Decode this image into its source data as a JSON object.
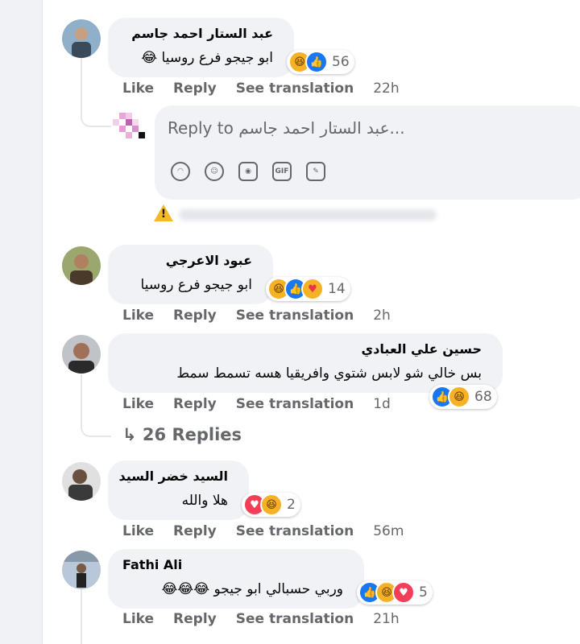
{
  "placeholder_avatar_note": "",
  "comments": [
    {
      "author": "عبد الستار احمد جاسم",
      "text": "ابو جيجو فرع روسيا",
      "text_emoji": "😂",
      "reactions": [
        "haha",
        "like"
      ],
      "reaction_count": "56",
      "actions": {
        "like": "Like",
        "reply": "Reply",
        "translate": "See translation",
        "time": "22h"
      },
      "avatar_color": "#6f8fa8"
    },
    {
      "author": "عبود الاعرجي",
      "text": "ابو جيجو فرع روسيا",
      "text_emoji": "",
      "reactions": [
        "haha",
        "like",
        "care"
      ],
      "reaction_count": "14",
      "actions": {
        "like": "Like",
        "reply": "Reply",
        "translate": "See translation",
        "time": "2h"
      },
      "avatar_color": "#6b7a4a"
    },
    {
      "author": "حسين علي العبادي",
      "text": "بس خالي شو لابس شتوي وافريقيا هسه تسمط سمط",
      "text_emoji": "",
      "reactions": [
        "like",
        "haha"
      ],
      "reaction_count": "68",
      "actions": {
        "like": "Like",
        "reply": "Reply",
        "translate": "See translation",
        "time": "1d"
      },
      "avatar_color": "#8a7a6a"
    },
    {
      "author": "السيد خضر السيد",
      "text": "هلا والله",
      "text_emoji": "",
      "reactions": [
        "love",
        "haha"
      ],
      "reaction_count": "2",
      "actions": {
        "like": "Like",
        "reply": "Reply",
        "translate": "See translation",
        "time": "56m"
      },
      "avatar_color": "#5c5c5c"
    },
    {
      "author": "Fathi Ali",
      "text": "وربي حسبالي ابو جيجو",
      "text_emoji": "😂😂😂",
      "reactions": [
        "like",
        "haha",
        "love"
      ],
      "reaction_count": "5",
      "actions": {
        "like": "Like",
        "reply": "Reply",
        "translate": "See translation",
        "time": "21h"
      },
      "avatar_color": "#7a8a9a"
    }
  ],
  "reply_box": {
    "placeholder": "Reply to عبد الستار احمد جاسم...",
    "icons": [
      "sticker-icon",
      "emoji-icon",
      "camera-icon",
      "gif-icon",
      "sticker-face-icon"
    ],
    "gif_label": "GIF"
  },
  "replies_link": "26 Replies",
  "replies_arrow": "↳"
}
